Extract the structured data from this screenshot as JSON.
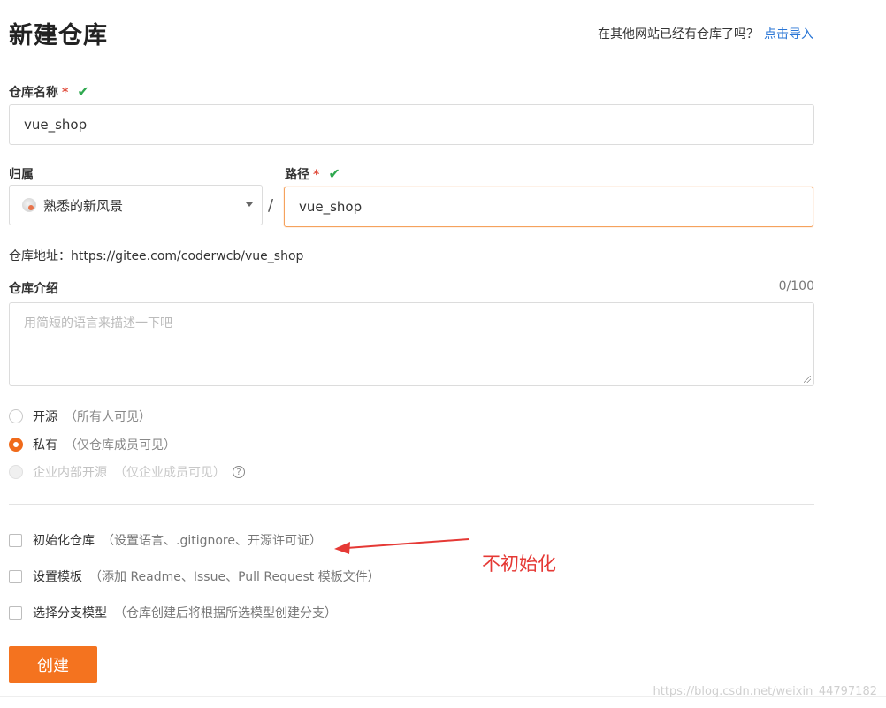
{
  "page": {
    "title": "新建仓库",
    "import_prompt": "在其他网站已经有仓库了吗？",
    "import_link": "点击导入"
  },
  "repo_name": {
    "label": "仓库名称",
    "required_mark": "*",
    "valid_icon": "check-icon",
    "value": "vue_shop"
  },
  "owner": {
    "label": "归属",
    "selected": "熟悉的新风景",
    "avatar_icon": "avatar-icon",
    "dropdown_icon": "caret-down-icon"
  },
  "separator": "/",
  "path": {
    "label": "路径",
    "required_mark": "*",
    "valid_icon": "check-icon",
    "value": "vue_shop"
  },
  "repo_address": {
    "label": "仓库地址：",
    "value": "https://gitee.com/coderwcb/vue_shop"
  },
  "description": {
    "label": "仓库介绍",
    "counter": "0/100",
    "placeholder": "用简短的语言来描述一下吧",
    "value": ""
  },
  "visibility": {
    "options": [
      {
        "label": "开源",
        "hint": "（所有人可见）",
        "selected": false,
        "disabled": false
      },
      {
        "label": "私有",
        "hint": "（仅仓库成员可见）",
        "selected": true,
        "disabled": false
      },
      {
        "label": "企业内部开源",
        "hint": "（仅企业成员可见）",
        "selected": false,
        "disabled": true
      }
    ],
    "help_icon": "question-circle-icon",
    "help_glyph": "?"
  },
  "options": {
    "init": {
      "label": "初始化仓库",
      "hint": "（设置语言、.gitignore、开源许可证）",
      "checked": false
    },
    "template": {
      "label": "设置模板",
      "hint": "（添加 Readme、Issue、Pull Request 模板文件）",
      "checked": false
    },
    "branch": {
      "label": "选择分支模型",
      "hint": "（仓库创建后将根据所选模型创建分支）",
      "checked": false
    }
  },
  "create_button": "创建",
  "annotation": {
    "text": "不初始化",
    "color": "#e53935"
  },
  "watermark": "https://blog.csdn.net/weixin_44797182",
  "colors": {
    "accent": "#f4731f",
    "link": "#2a76d6",
    "valid": "#2fa84f",
    "required": "#e04b3b"
  }
}
